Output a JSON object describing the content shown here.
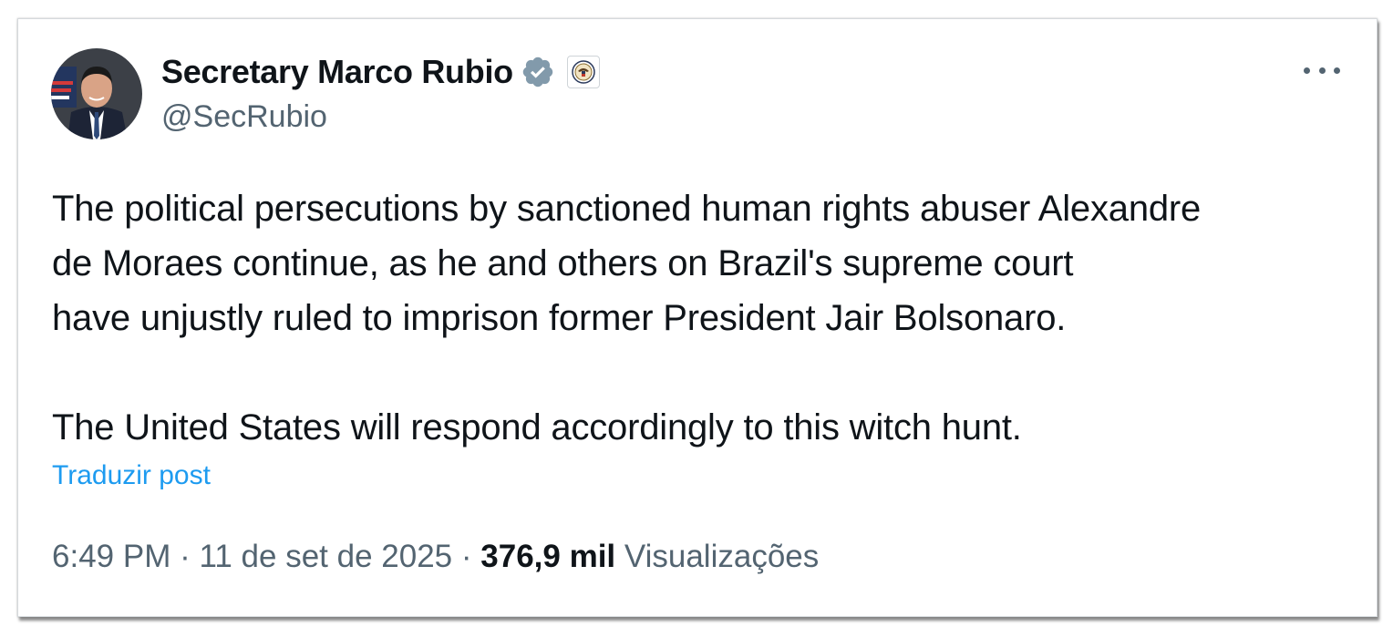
{
  "author": {
    "display_name": "Secretary Marco Rubio",
    "handle": "@SecRubio",
    "avatar_icon": "profile-photo",
    "verified_icon": "verified-badge-icon",
    "verified_color": "#829aab",
    "affiliate_icon": "state-department-seal-icon"
  },
  "tweet": {
    "paragraph_1_lines": [
      "The political persecutions by sanctioned human rights abuser Alexandre",
      "de Moraes continue, as he and others on Brazil's supreme court",
      "have unjustly ruled to imprison former President Jair Bolsonaro."
    ],
    "paragraph_2": "The United States will respond accordingly to this witch hunt.",
    "translate_label": "Traduzir post"
  },
  "meta": {
    "time": "6:49 PM",
    "separator": "·",
    "date": "11 de set de 2025",
    "views_count": "376,9 mil",
    "views_label": "Visualizações"
  },
  "colors": {
    "text": "#0f1419",
    "secondary": "#536471",
    "link": "#1d9bf0"
  }
}
